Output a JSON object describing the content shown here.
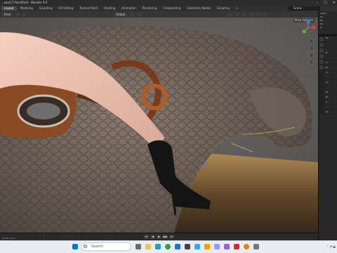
{
  "window": {
    "title": "...saur17-Rectified] - Blender 4.0",
    "minimize": "–",
    "maximize": "□",
    "close": "✕"
  },
  "menubar": {
    "tabs": [
      "Layout",
      "Modeling",
      "Sculpting",
      "UV Editing",
      "Texture Paint",
      "Shading",
      "Animation",
      "Rendering",
      "Compositing",
      "Geometry Nodes",
      "Scripting",
      "+"
    ],
    "active_tab": "Layout",
    "scene_label": "Scene"
  },
  "viewport": {
    "mode": "Pose",
    "transform": "Global",
    "overlay_label": "Pose Options",
    "gizmo_axes": [
      "X",
      "Y",
      "Z"
    ]
  },
  "right_panel": {
    "outliner_rows": [
      "Scene",
      "Co",
      "Sa",
      "Ca",
      "Li"
    ],
    "properties_rows": [
      "Sp",
      "",
      "",
      "Fi",
      "",
      "Ti",
      "Di",
      "Ti",
      "",
      "Gi",
      "",
      "Bi",
      "Br",
      "Li",
      "",
      "Po"
    ]
  },
  "timeline": {
    "buttons": [
      "⏮",
      "◀",
      "▶",
      "▶▶",
      "⏭"
    ]
  },
  "statusbar": {
    "text": "Rotate View"
  },
  "taskbar": {
    "search_placeholder": "Search",
    "icons": [
      "start",
      "search",
      "task-view",
      "explorer",
      "edge",
      "chrome",
      "mail",
      "store",
      "photoshop",
      "illustrator",
      "premiere",
      "after-effects",
      "acrobat",
      "blender",
      "settings"
    ],
    "colors": {
      "start": "#0078d4",
      "edge": "#1fa0c6",
      "photoshop": "#31a8ff",
      "illustrator": "#ff9a00",
      "blender": "#e87d0d",
      "acrobat": "#d7282f"
    }
  }
}
